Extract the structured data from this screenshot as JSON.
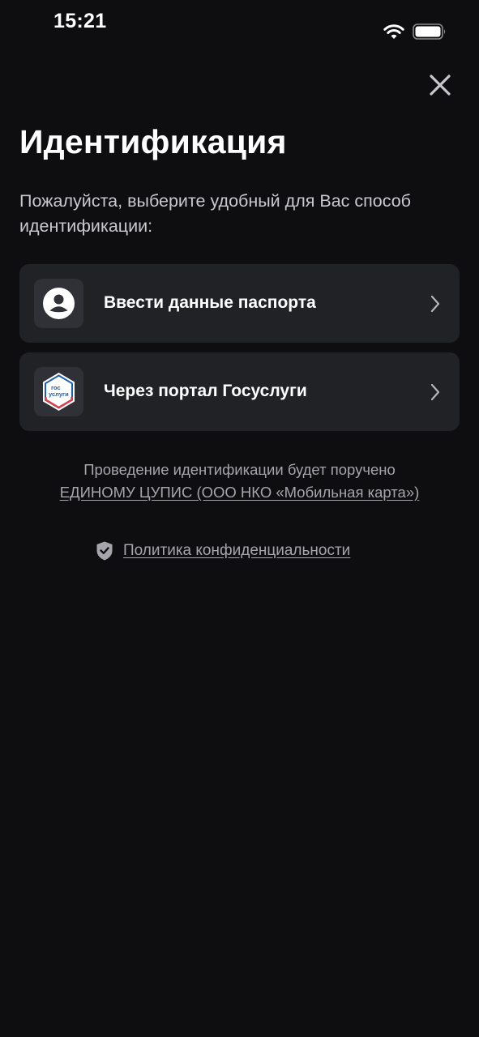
{
  "status_bar": {
    "time": "15:21",
    "icons": [
      "wifi-icon",
      "battery-icon"
    ]
  },
  "header": {
    "close_icon": "close-icon",
    "title": "Идентификация",
    "subtitle": "Пожалуйста, выберите удобный для Вас способ идентификации:"
  },
  "options": [
    {
      "label": "Ввести данные паспорта",
      "icon": "user-avatar-icon"
    },
    {
      "label": "Через портал Госуслуги",
      "icon": "gosuslugi-logo-icon",
      "logo_text_top": "гос",
      "logo_text_bottom": "услуги"
    }
  ],
  "info": {
    "text": "Проведение идентификации будет поручено",
    "link": "ЕДИНОМУ ЦУПИС (ООО НКО «Мобильная карта»)"
  },
  "privacy": {
    "icon": "shield-check-icon",
    "link": "Политика конфиденциальности"
  },
  "colors": {
    "background": "#0e0e10",
    "card": "#212226",
    "icon_box": "#303136",
    "muted_text": "#a5a5ab",
    "gosuslugi_blue": "#1b5fb0",
    "gosuslugi_red": "#e23d43"
  }
}
